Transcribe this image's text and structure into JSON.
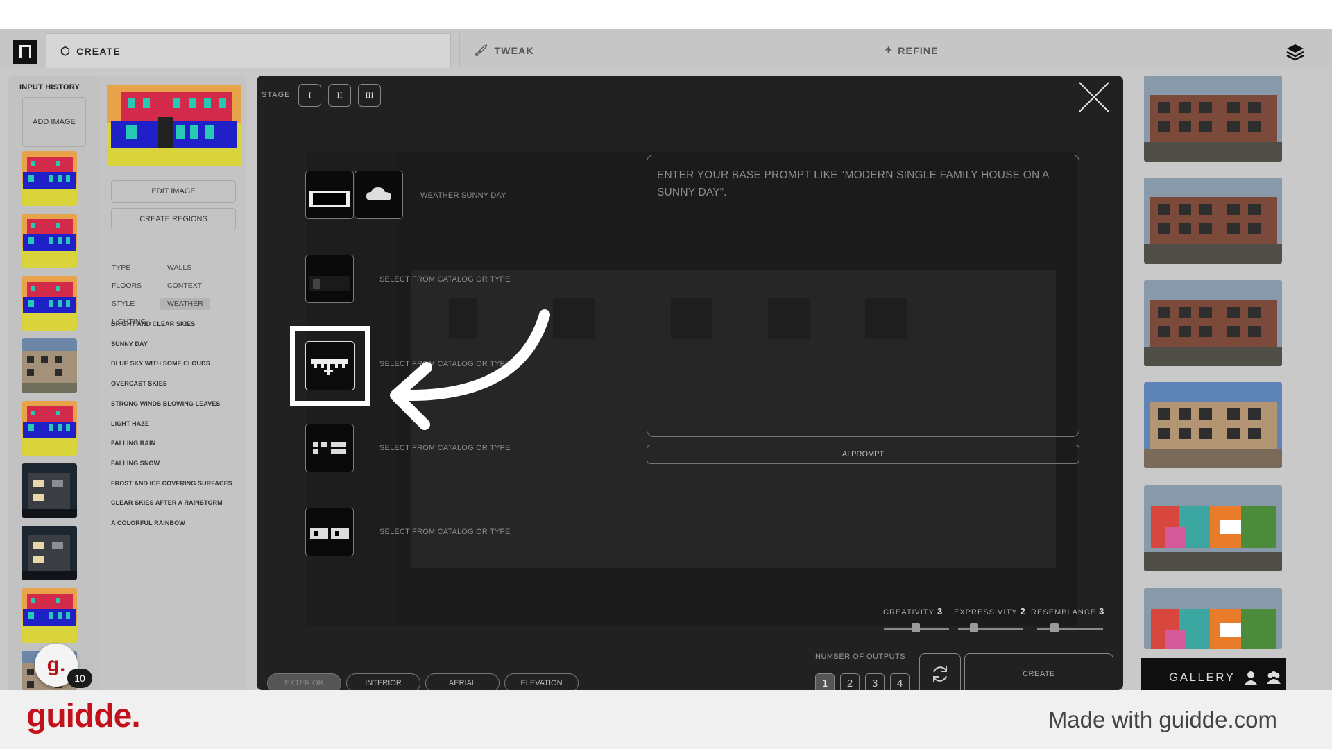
{
  "tabs": [
    {
      "label": "CREATE",
      "icon": "cube-icon",
      "active": true
    },
    {
      "label": "TWEAK",
      "icon": "brush-icon",
      "active": false
    },
    {
      "label": "REFINE",
      "icon": "crosshair-icon",
      "active": false
    }
  ],
  "history": {
    "title": "INPUT HISTORY",
    "add_label": "ADD IMAGE",
    "thumbs": [
      "massing",
      "massing",
      "massing",
      "render-brick",
      "massing",
      "render-night",
      "render-night",
      "massing",
      "render-brick"
    ]
  },
  "options": {
    "edit_image": "EDIT IMAGE",
    "create_regions": "CREATE REGIONS",
    "categories": [
      "TYPE",
      "WALLS",
      "FLOORS",
      "CONTEXT",
      "STYLE",
      "WEATHER",
      "LIGHTING"
    ],
    "selected_category": "WEATHER",
    "weather_items": [
      "BRIGHT AND CLEAR SKIES",
      "SUNNY DAY",
      "BLUE SKY WITH SOME CLOUDS",
      "OVERCAST SKIES",
      "STRONG WINDS BLOWING LEAVES",
      "LIGHT HAZE",
      "FALLING RAIN",
      "FALLING SNOW",
      "FROST AND ICE COVERING SURFACES",
      "CLEAR SKIES AFTER A RAINSTORM",
      "A COLORFUL RAINBOW"
    ]
  },
  "modal": {
    "stage_label": "STAGE",
    "stages": [
      "I",
      "II",
      "III"
    ],
    "slot_labels": {
      "weather": "WEATHER SUNNY DAY",
      "catalog": "SELECT FROM CATALOG OR TYPE"
    },
    "prompt_placeholder": "ENTER YOUR BASE PROMPT LIKE “MODERN SINGLE FAMILY HOUSE ON A SUNNY DAY”.",
    "ai_prompt": "AI PROMPT",
    "sliders": [
      {
        "label": "CREATIVITY",
        "value": "3"
      },
      {
        "label": "EXPRESSIVITY",
        "value": "2"
      },
      {
        "label": "RESEMBLANCE",
        "value": "3"
      }
    ],
    "outputs_label": "NUMBER OF OUTPUTS",
    "outputs": [
      "1",
      "2",
      "3",
      "4"
    ],
    "selected_output": "1",
    "create_label": "CREATE",
    "modes": [
      "EXTERIOR",
      "INTERIOR",
      "AERIAL",
      "ELEVATION"
    ],
    "selected_mode": "EXTERIOR"
  },
  "gallery": {
    "label": "GALLERY",
    "renders": [
      "brick-dark",
      "brick-dark",
      "brick-dark",
      "brick-light",
      "colorful",
      "colorful-partial"
    ]
  },
  "notification": {
    "letter": "g.",
    "count": "10"
  },
  "footer": {
    "brand": "guidde.",
    "tagline": "Made with guidde.com"
  },
  "colors": {
    "brand_red": "#c3111c",
    "modal_bg": "#212121",
    "app_bg": "#c9c9c9"
  }
}
